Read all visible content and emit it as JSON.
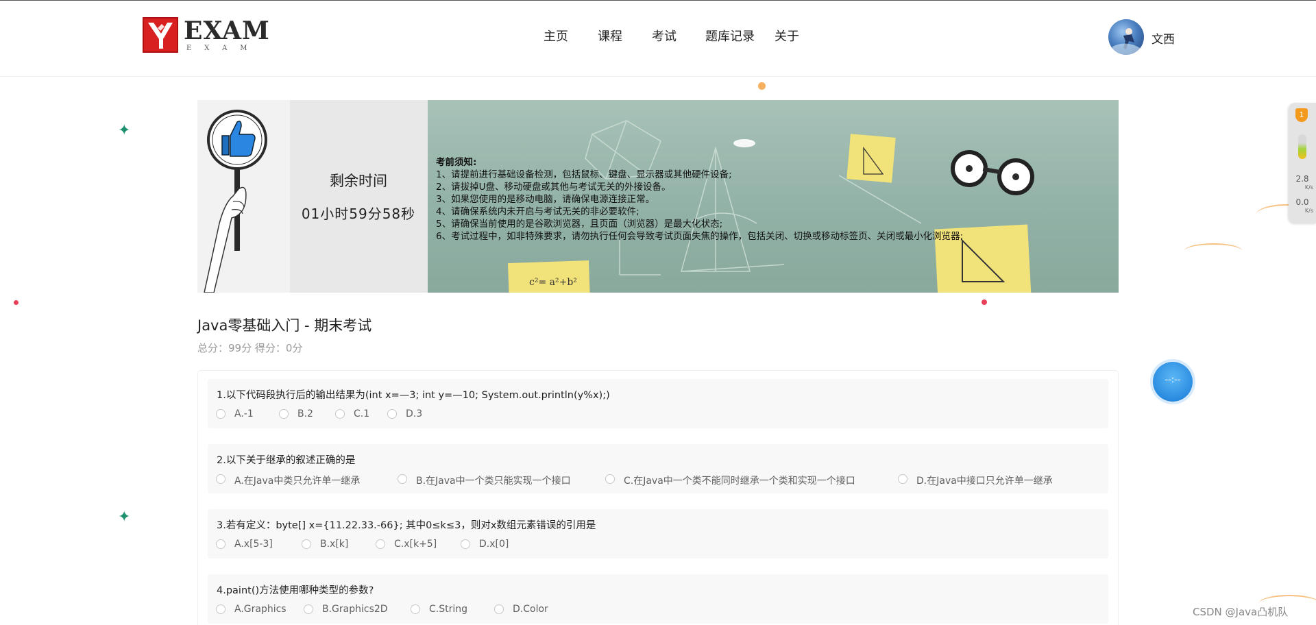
{
  "brand": {
    "logo_text": "EXAM",
    "logo_sub": "EXAM"
  },
  "nav": {
    "items": [
      {
        "label": "主页"
      },
      {
        "label": "课程"
      },
      {
        "label": "考试"
      },
      {
        "label": "题库记录"
      },
      {
        "label": "关于"
      }
    ]
  },
  "user": {
    "name": "文西"
  },
  "timer": {
    "label": "剩余时间",
    "value": "01小时59分58秒"
  },
  "notice": {
    "title": "考前须知:",
    "lines": [
      "1、请提前进行基础设备检测，包括鼠标、键盘、显示器或其他硬件设备;",
      "2、请拔掉U盘、移动硬盘或其他与考试无关的外接设备。",
      "3、如果您使用的是移动电脑，请确保电源连接正常。",
      "4、请确保系统内未开启与考试无关的非必要软件;",
      "5、请确保当前使用的是谷歌浏览器，且页面（浏览器）是最大化状态;",
      "6、考试过程中，如非特殊要求，请勿执行任何会导致考试页面失焦的操作，包括关闭、切换或移动标签页、关闭或最小化浏览器;"
    ]
  },
  "exam": {
    "title": "Java零基础入门 - 期末考试",
    "score_line": "总分：99分  得分：0分"
  },
  "questions": [
    {
      "text": "1.以下代码段执行后的输出结果为(int x=—3;  int y=—10;  System.out.println(y%x);)",
      "options": [
        "A.-1",
        "B.2",
        "C.1",
        "D.3"
      ]
    },
    {
      "text": "2.以下关于继承的叙述正确的是",
      "options": [
        "A.在Java中类只允许单一继承",
        "B.在Java中一个类只能实现一个接口",
        "C.在Java中一个类不能同时继承一个类和实现一个接口",
        "D.在Java中接口只允许单一继承"
      ]
    },
    {
      "text": "3.若有定义：byte[] x={11.22.33.-66}; 其中0≤k≤3，则对x数组元素错误的引用是",
      "options": [
        "A.x[5-3]",
        "B.x[k]",
        "C.x[k+5]",
        "D.x[0]"
      ]
    },
    {
      "text": "4.paint()方法使用哪种类型的参数?",
      "options": [
        "A.Graphics",
        "B.Graphics2D",
        "C.String",
        "D.Color"
      ]
    }
  ],
  "float_button": {
    "label": "--:--"
  },
  "side_widget": {
    "badge": "1",
    "up_value": "2.8",
    "up_unit": "K/s",
    "down_value": "0.0",
    "down_unit": "K/s"
  },
  "watermark": "CSDN @Java凸机队",
  "colors": {
    "brand_red": "#d92020",
    "accent_blue": "#2a8ce0",
    "sparkle_green": "#1e9070",
    "banner_green": "#93b2a7"
  }
}
